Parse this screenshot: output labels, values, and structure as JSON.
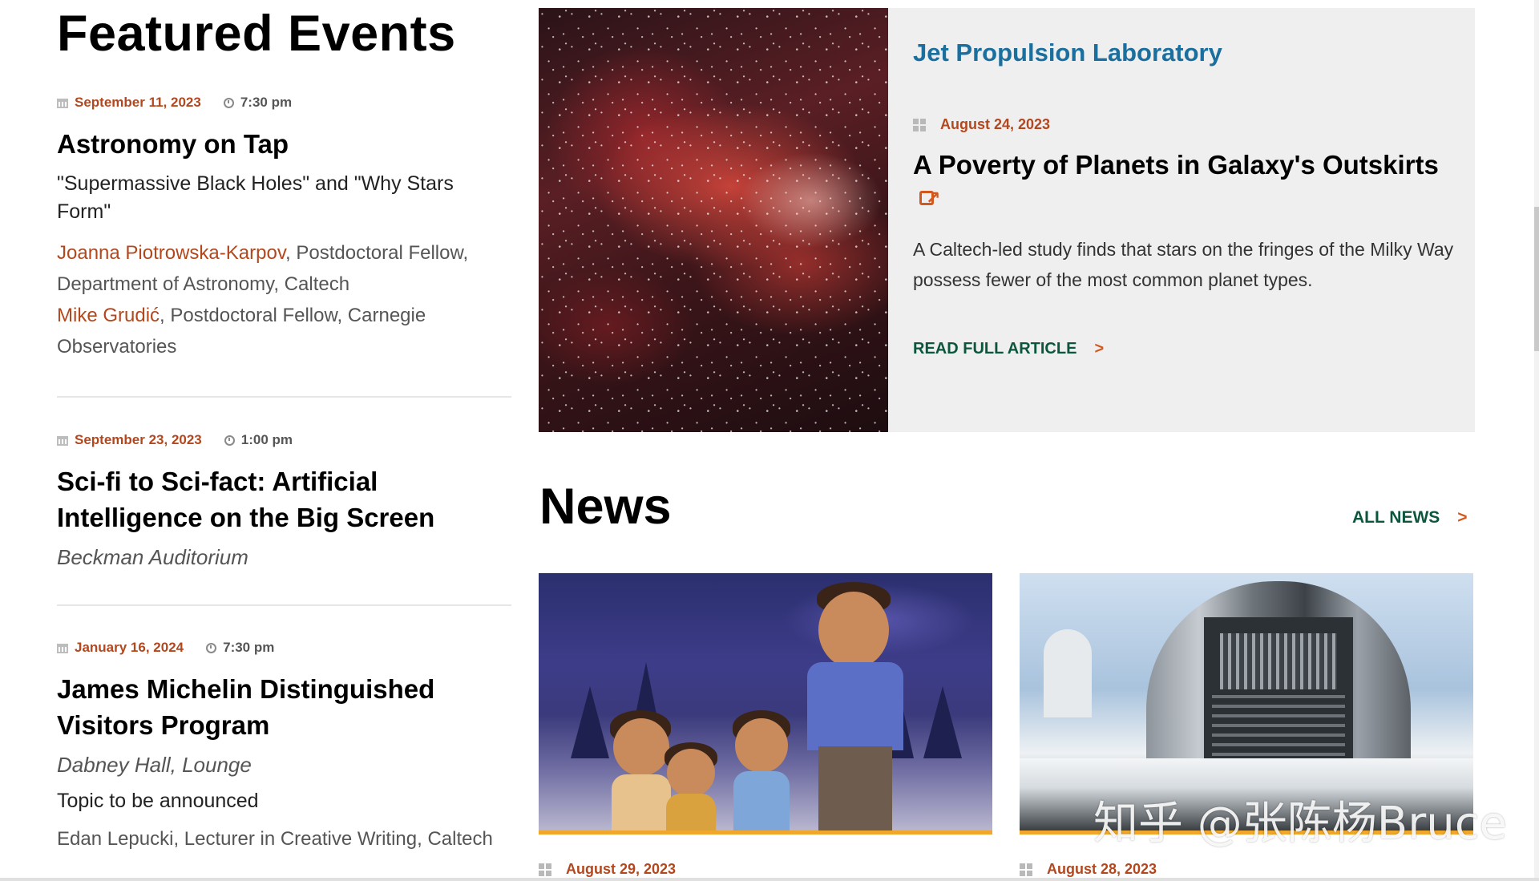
{
  "featured": {
    "heading": "Featured Events",
    "events": [
      {
        "date": "September 11, 2023",
        "time": "7:30 pm",
        "title": "Astronomy on Tap",
        "subtitle": "\"Supermassive Black Holes\" and \"Why Stars Form\"",
        "speakers": [
          {
            "name": "Joanna Piotrowska-Karpov",
            "affiliation": ", Postdoctoral Fellow, Department of Astronomy, Caltech"
          },
          {
            "name": "Mike Grudić",
            "affiliation": ", Postdoctoral Fellow, Carnegie Observatories"
          }
        ]
      },
      {
        "date": "September 23, 2023",
        "time": "1:00 pm",
        "title": "Sci-fi to Sci-fact: Artificial Intelligence on the Big Screen",
        "location": "Beckman Auditorium"
      },
      {
        "date": "January 16, 2024",
        "time": "7:30 pm",
        "title": "James Michelin Distinguished Visitors Program",
        "location": "Dabney Hall, Lounge",
        "topic": "Topic to be announced",
        "speaker_text": "Edan Lepucki, Lecturer in Creative Writing, Caltech"
      }
    ]
  },
  "jpl": {
    "source": "Jet Propulsion Laboratory",
    "date": "August 24, 2023",
    "title": "A Poverty of Planets in Galaxy's Outskirts",
    "description": "A Caltech-led study finds that stars on the fringes of the Milky Way possess fewer of the most common planet types.",
    "read_more": "READ FULL ARTICLE",
    "chevron": ">"
  },
  "news": {
    "heading": "News",
    "all_news": "ALL NEWS",
    "chevron": ">",
    "items": [
      {
        "date": "August 29, 2023"
      },
      {
        "date": "August 28, 2023"
      }
    ]
  },
  "watermark": "知乎 @张陈杨Bruce",
  "icons": {
    "calendar": "calendar-icon",
    "clock": "clock-icon",
    "grid": "grid-icon",
    "external": "external-link-icon"
  },
  "colors": {
    "date": "#b3471e",
    "jpl_source": "#1a6f9e",
    "link_green": "#0c5640",
    "accent_orange": "#d2581e",
    "news_underline": "#f0a72b",
    "card_bg": "#efefef"
  }
}
